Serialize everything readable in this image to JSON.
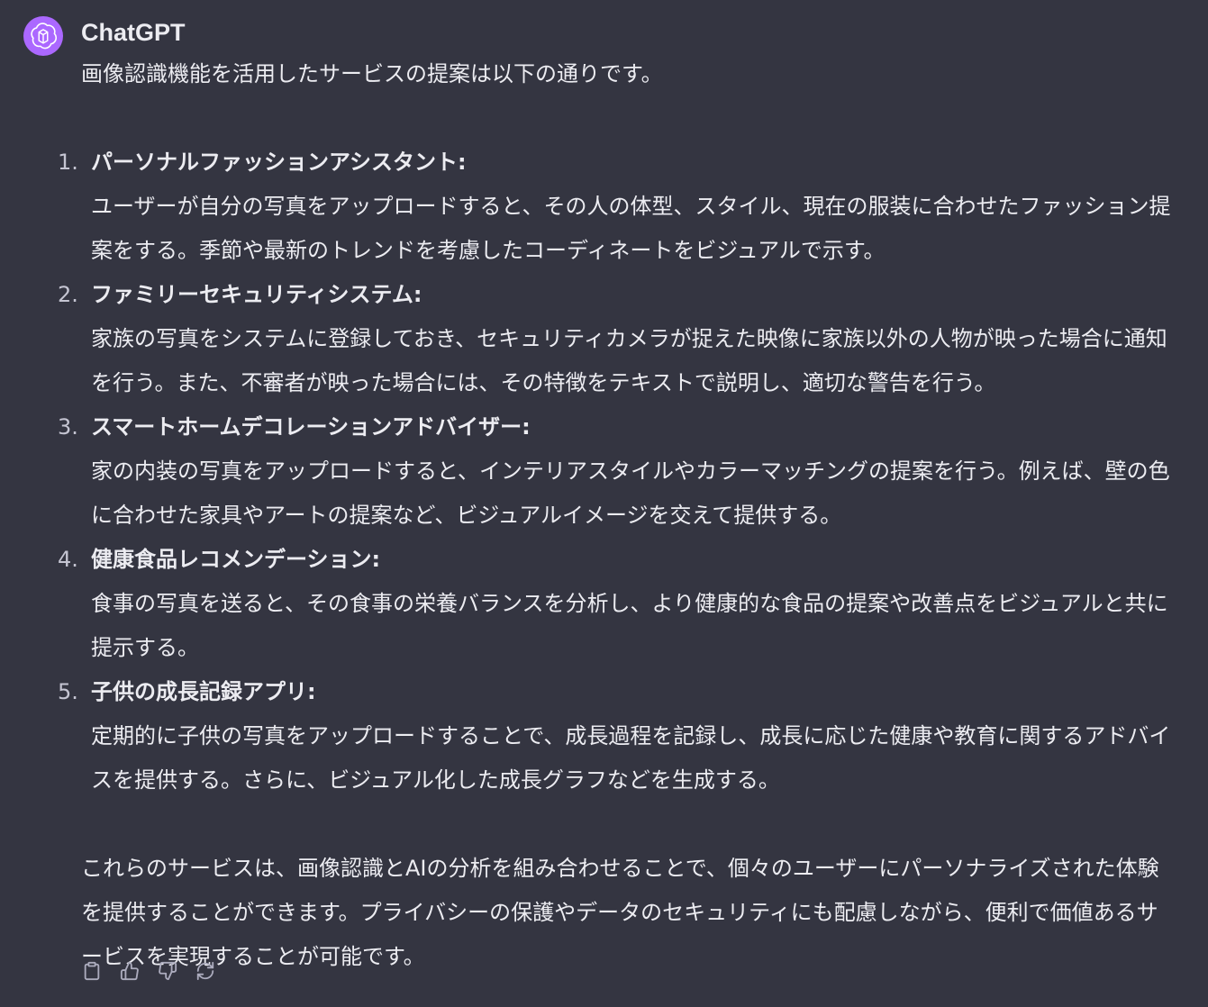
{
  "sender": {
    "name": "ChatGPT",
    "avatar_icon": "openai-logo-icon",
    "avatar_color": "#ab68ff"
  },
  "message": {
    "intro": "画像認識機能を活用したサービスの提案は以下の通りです。",
    "items": [
      {
        "number": "1.",
        "title": "パーソナルファッションアシスタント:",
        "body": "ユーザーが自分の写真をアップロードすると、その人の体型、スタイル、現在の服装に合わせたファッション提案をする。季節や最新のトレンドを考慮したコーディネートをビジュアルで示す。"
      },
      {
        "number": "2.",
        "title": "ファミリーセキュリティシステム:",
        "body": "家族の写真をシステムに登録しておき、セキュリティカメラが捉えた映像に家族以外の人物が映った場合に通知を行う。また、不審者が映った場合には、その特徴をテキストで説明し、適切な警告を行う。"
      },
      {
        "number": "3.",
        "title": "スマートホームデコレーションアドバイザー:",
        "body": "家の内装の写真をアップロードすると、インテリアスタイルやカラーマッチングの提案を行う。例えば、壁の色に合わせた家具やアートの提案など、ビジュアルイメージを交えて提供する。"
      },
      {
        "number": "4.",
        "title": "健康食品レコメンデーション:",
        "body": "食事の写真を送ると、その食事の栄養バランスを分析し、より健康的な食品の提案や改善点をビジュアルと共に提示する。"
      },
      {
        "number": "5.",
        "title": "子供の成長記録アプリ:",
        "body": "定期的に子供の写真をアップロードすることで、成長過程を記録し、成長に応じた健康や教育に関するアドバイスを提供する。さらに、ビジュアル化した成長グラフなどを生成する。"
      }
    ],
    "outro": "これらのサービスは、画像認識とAIの分析を組み合わせることで、個々のユーザーにパーソナライズされた体験を提供することができます。プライバシーの保護やデータのセキュリティにも配慮しながら、便利で価値あるサービスを実現することが可能です。"
  },
  "actions": [
    {
      "icon": "clipboard-icon"
    },
    {
      "icon": "thumbs-up-icon"
    },
    {
      "icon": "thumbs-down-icon"
    },
    {
      "icon": "regenerate-icon"
    }
  ],
  "colors": {
    "background": "#343541",
    "text": "#ececf1",
    "muted": "#c5c5d2"
  }
}
